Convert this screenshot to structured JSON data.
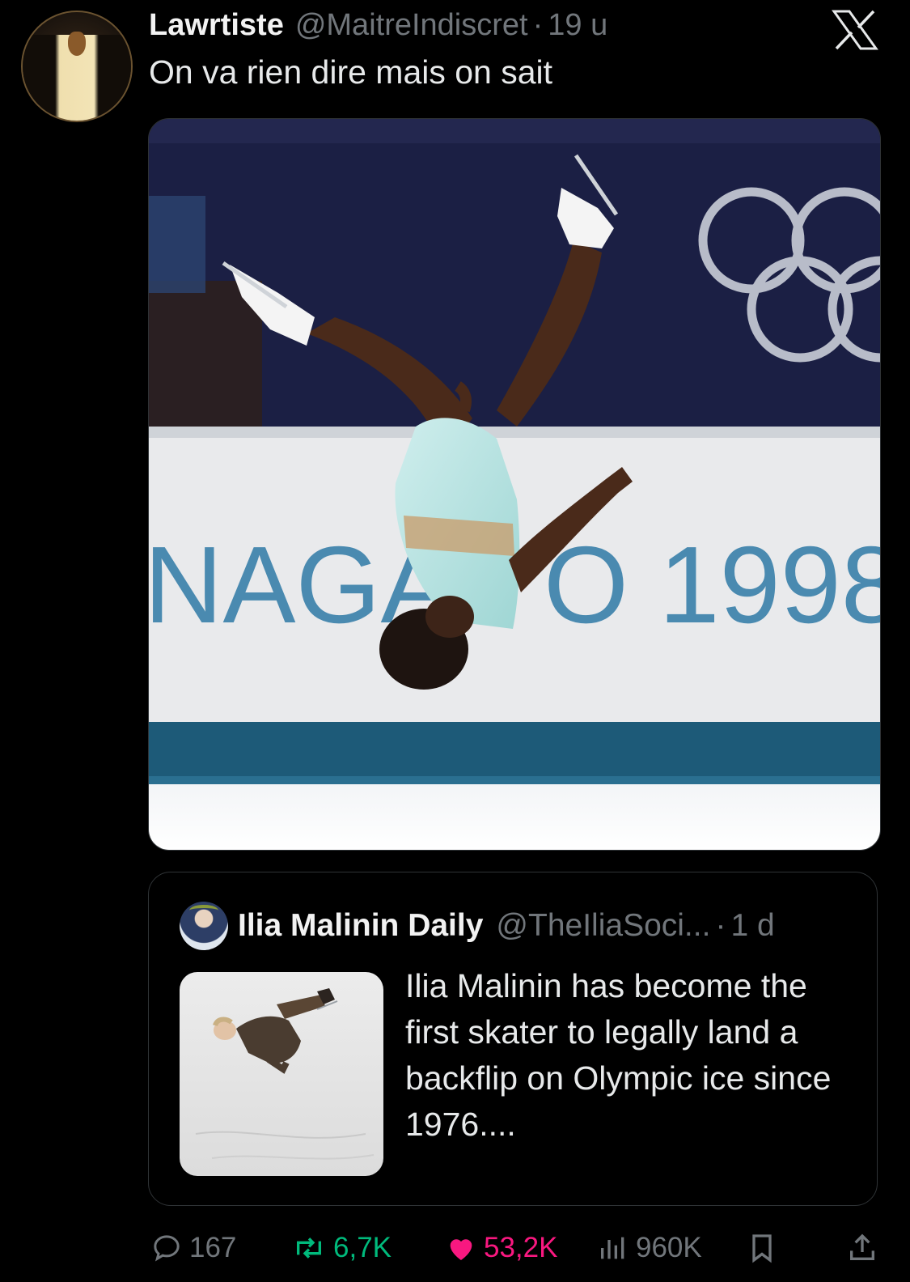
{
  "tweet": {
    "display_name": "Lawrtiste",
    "handle": "@MaitreIndiscret",
    "separator": "·",
    "time": "19 u",
    "text": "On va rien dire mais on sait",
    "photo": {
      "banner_text": "NAGA",
      "banner_text_2": "O 1998"
    }
  },
  "quoted": {
    "display_name": "Ilia Malinin Daily",
    "handle": "@TheIliaSoci...",
    "separator": "·",
    "time": "1 d",
    "text": "Ilia Malinin has become the first skater to legally land a backflip on Olympic ice since 1976...."
  },
  "actions": {
    "replies": "167",
    "reposts": "6,7K",
    "likes": "53,2K",
    "views": "960K"
  },
  "colors": {
    "background": "#000000",
    "secondary_text": "#71767b",
    "like": "#f91880",
    "repost": "#00ba7c",
    "border": "#2f3336"
  },
  "icons": [
    "x-logo-icon",
    "reply-icon",
    "repost-icon",
    "heart-icon",
    "views-icon",
    "bookmark-icon",
    "share-icon"
  ]
}
